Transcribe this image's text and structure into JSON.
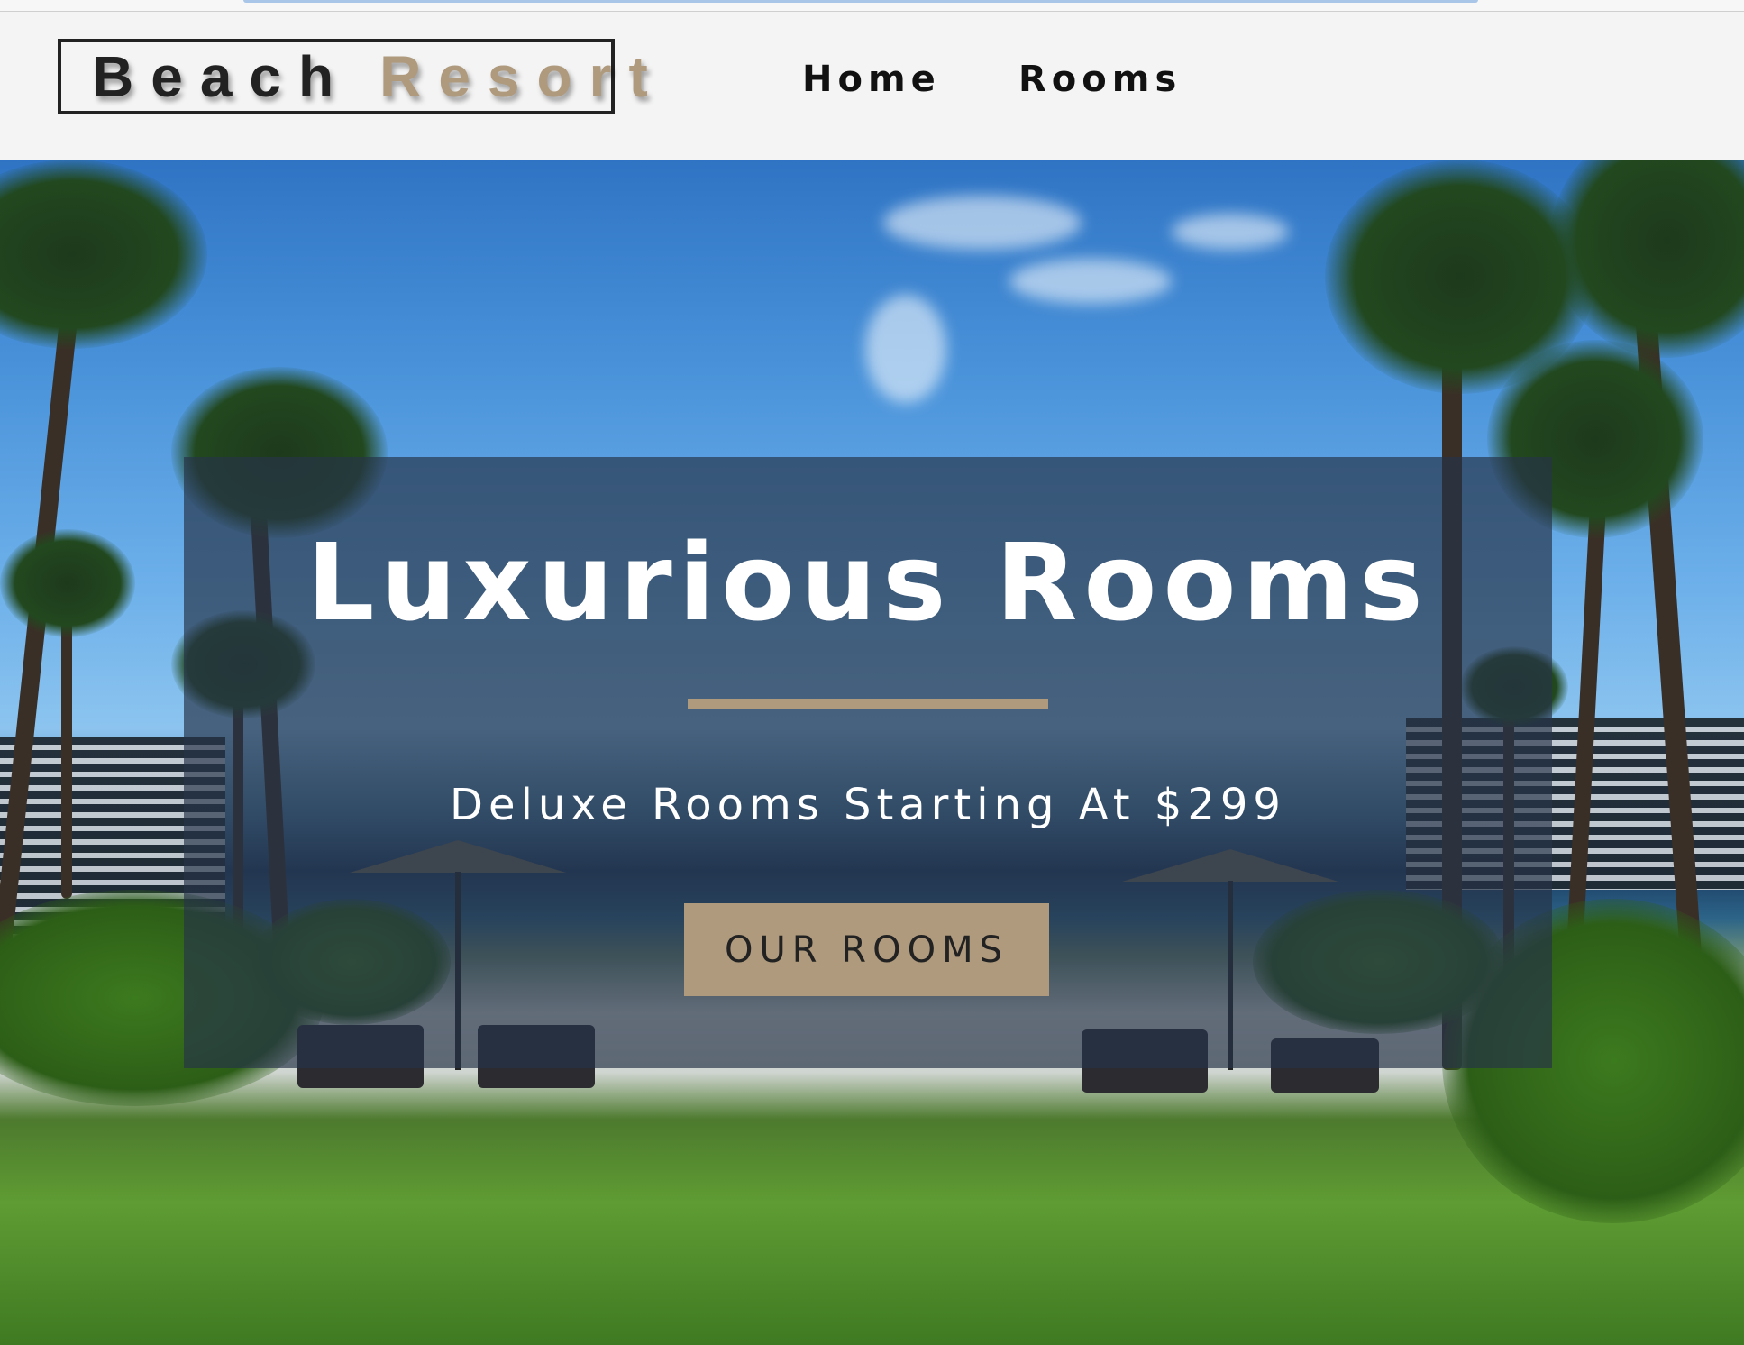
{
  "navbar": {
    "logo": {
      "word1": "Beach",
      "word2": "Resort"
    },
    "links": [
      {
        "label": "Home"
      },
      {
        "label": "Rooms"
      }
    ]
  },
  "hero": {
    "title": "Luxurious Rooms",
    "subtitle": "Deluxe Rooms Starting At $299",
    "cta_label": "OUR ROOMS"
  },
  "colors": {
    "accent": "#af9a7d",
    "dark": "#222222",
    "banner_overlay": "rgba(38,52,72,0.68)",
    "navbar_bg": "#f4f4f4"
  }
}
